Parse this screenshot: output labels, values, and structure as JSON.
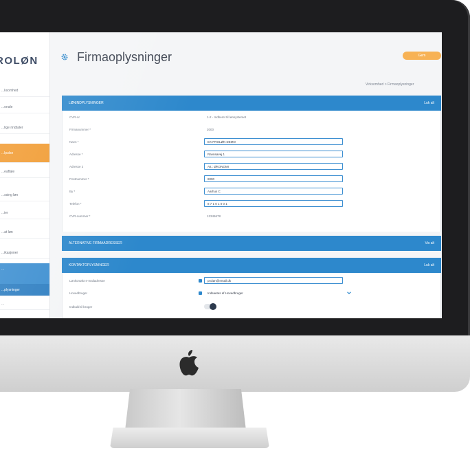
{
  "sidebar": {
    "brand": "ROLØN",
    "items": [
      {
        "label": "...ksomhed"
      },
      {
        "label": "...onale"
      },
      {
        "label": "...lige rindtaler"
      },
      {
        "label": "...lpulse"
      },
      {
        "label": "...eaftale"
      },
      {
        "label": "...ssing løn"
      },
      {
        "label": "...ier"
      },
      {
        "label": "...at løn"
      },
      {
        "label": "...ikasjoner"
      },
      {
        "label": "..."
      },
      {
        "label": "...plysninger"
      },
      {
        "label": "..."
      }
    ]
  },
  "header": {
    "title": "Firmaoplysninger",
    "save_label": "Gem",
    "breadcrumb": "Virksomhed > Firmaoplysninger"
  },
  "panels": [
    {
      "title": "LØNINDPLYSNINGER",
      "toggle": "Luk alt",
      "rows": [
        {
          "label": "CVR-nr",
          "value": "1-2 - Indberet til lønsystemet",
          "kind": "text"
        },
        {
          "label": "Firmanummer *",
          "value": "2000",
          "kind": "text"
        },
        {
          "label": "Navn *",
          "value": "EX PROLØN DEMO",
          "kind": "input"
        },
        {
          "label": "Adresse *",
          "value": "Ravnsøvej 1",
          "kind": "input"
        },
        {
          "label": "Adresse 2",
          "value": "Att.: ØKONOMI",
          "kind": "input"
        },
        {
          "label": "Postnummer *",
          "value": "8000",
          "kind": "input"
        },
        {
          "label": "By *",
          "value": "Aarhus C",
          "kind": "input"
        },
        {
          "label": "Telefon *",
          "value": "8 7 1 0 1 0 0 1",
          "kind": "input"
        },
        {
          "label": "CVR-nummer *",
          "value": "12345678",
          "kind": "text"
        }
      ]
    },
    {
      "title": "ALTERNATIVE FIRMAADRESSER",
      "toggle": "Vis alt"
    },
    {
      "title": "KONTAKTOPLYSNINGER",
      "toggle": "Luk alt",
      "rows": [
        {
          "label": "Lønkontakt e-mailadresse",
          "value": "proløn@email.dk",
          "kind": "input"
        },
        {
          "label": "Hovedbruger",
          "value": "Indsaetes af Hovedbruger",
          "kind": "input"
        },
        {
          "label": "Indkald til bruger",
          "value": "",
          "kind": "toggle"
        }
      ]
    }
  ],
  "colors": {
    "accent": "#2d88cc",
    "active": "#f19a2f",
    "save": "#f7b255",
    "text": "#3c4350"
  },
  "icons": {
    "title": "gear-icon",
    "hardware": "apple-logo-icon"
  }
}
